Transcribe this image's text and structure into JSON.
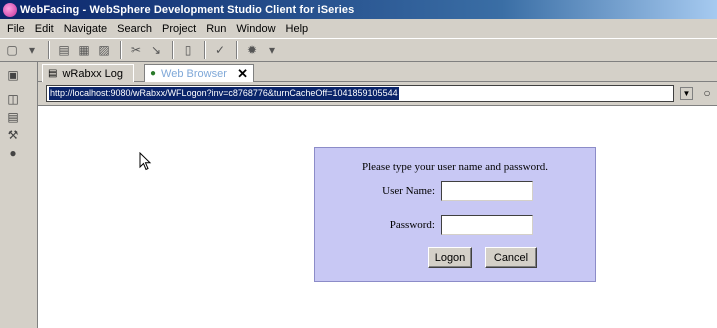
{
  "window": {
    "title": "WebFacing - WebSphere Development Studio Client for iSeries"
  },
  "menu": [
    "File",
    "Edit",
    "Navigate",
    "Search",
    "Project",
    "Run",
    "Window",
    "Help"
  ],
  "tabs": [
    {
      "label": "wRabxx Log"
    },
    {
      "label": "Web Browser"
    }
  ],
  "address": {
    "url": "http://localhost:9080/wRabxx/WFLogon?inv=c8768776&turnCacheOff=1041859105544"
  },
  "logon": {
    "prompt": "Please type your user name and password.",
    "username_label": "User Name:",
    "username_value": "",
    "password_label": "Password:",
    "password_value": "",
    "logon_button": "Logon",
    "cancel_button": "Cancel"
  }
}
